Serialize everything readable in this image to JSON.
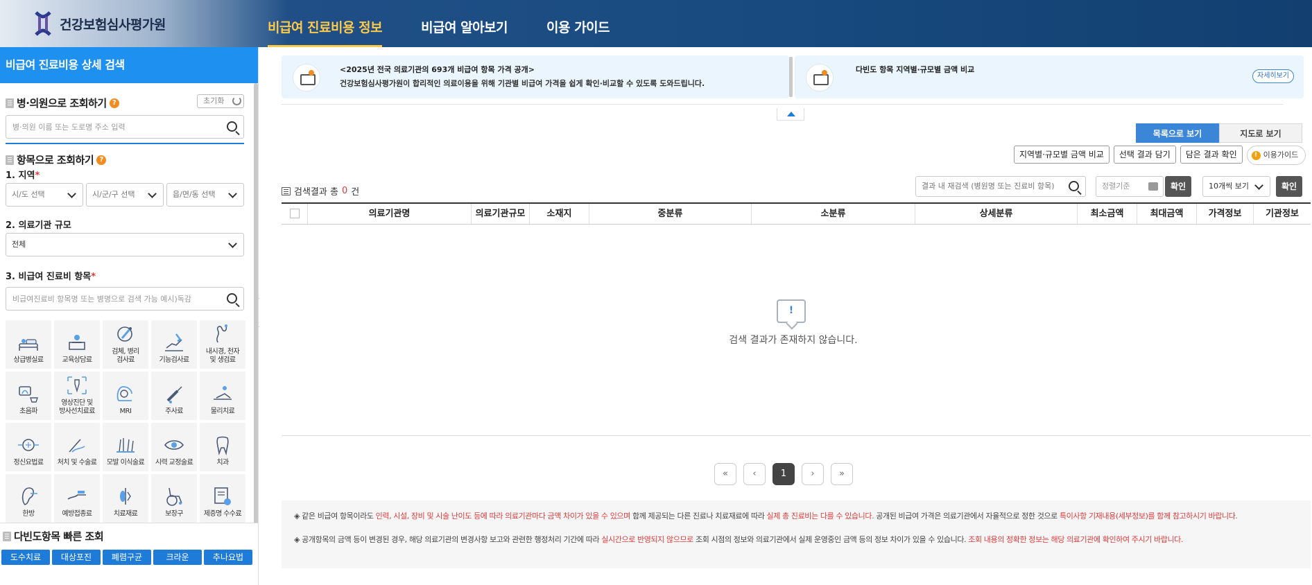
{
  "brand": {
    "name": "건강보험심사평가원"
  },
  "gnb": [
    {
      "label": "비급여 진료비용 정보"
    },
    {
      "label": "비급여 알아보기"
    },
    {
      "label": "이용 가이드"
    }
  ],
  "sidebar": {
    "title": "비급여 진료비용 상세 검색",
    "hospital_search": {
      "heading": "병·의원으로 조회하기",
      "reset_label": "초기화",
      "placeholder": "병·의원 이름 또는 도로명 주소 입력"
    },
    "item_search": {
      "heading": "항목으로 조회하기",
      "region_label": "1. 지역",
      "region_selects": [
        "시/도 선택",
        "시/군/구 선택",
        "읍/면/동 선택"
      ],
      "scale_label": "2. 의료기관 규모",
      "scale_value": "전체",
      "item_label": "3. 비급여 진료비 항목",
      "item_placeholder": "비급여진료비 항목명 또는 병명으로 검색 가능 예시)독감",
      "required_mark": "*"
    },
    "categories": [
      {
        "label": "상급병실료",
        "icon": "bed-icon"
      },
      {
        "label": "교육상담료",
        "icon": "counseling-icon"
      },
      {
        "label": "검체, 병리\n검사료",
        "icon": "test-tube-icon"
      },
      {
        "label": "기능검사료",
        "icon": "function-test-icon"
      },
      {
        "label": "내시경, 천자\n및 생검료",
        "icon": "endoscope-icon"
      },
      {
        "label": "초음파",
        "icon": "ultrasound-icon"
      },
      {
        "label": "영상진단 및\n방사선치료료",
        "icon": "radiology-icon"
      },
      {
        "label": "MRI",
        "icon": "mri-icon"
      },
      {
        "label": "주사료",
        "icon": "syringe-icon"
      },
      {
        "label": "물리치료",
        "icon": "physio-icon"
      },
      {
        "label": "정신요법료",
        "icon": "brain-icon"
      },
      {
        "label": "처치 및 수술료",
        "icon": "surgery-icon"
      },
      {
        "label": "모발 이식술료",
        "icon": "hair-icon"
      },
      {
        "label": "시력 교정술료",
        "icon": "eye-icon"
      },
      {
        "label": "치과",
        "icon": "tooth-icon"
      },
      {
        "label": "한방",
        "icon": "ear-acupuncture-icon"
      },
      {
        "label": "예방접종료",
        "icon": "vaccine-icon"
      },
      {
        "label": "치료재료",
        "icon": "material-icon"
      },
      {
        "label": "보장구",
        "icon": "wheelchair-icon"
      },
      {
        "label": "제증명 수수료",
        "icon": "certificate-icon"
      }
    ],
    "quick": {
      "heading": "다빈도항목 빠른 조회",
      "buttons": [
        "도수치료",
        "대상포진",
        "폐렴구균",
        "크라운",
        "추나요법"
      ]
    }
  },
  "main": {
    "banners": [
      {
        "line1": "<2025년 전국 의료기관의 693개 비급여 항목 가격 공개>",
        "line2": "건강보험심사평가원이 합리적인 의료이용을 위해 기관별 비급여 가격을 쉽게 확인·비교할 수 있도록 도와드립니다."
      },
      {
        "line1": "다빈도 항목 지역별·규모별 금액 비교",
        "more_label": "자세히보기"
      }
    ],
    "view_tabs": [
      "목록으로 보기",
      "지도로 보기"
    ],
    "actions": [
      "지역별·규모별 금액 비교",
      "선택 결과 담기",
      "담은 결과 확인"
    ],
    "guide_label": "이용가이드",
    "result": {
      "prefix": "검색결과 총",
      "count": "0",
      "suffix": "건"
    },
    "filter": {
      "search_placeholder": "결과 내 재검색 (병원명 또는 진료비 항목)",
      "sort_placeholder": "정렬기준",
      "confirm_label": "확인",
      "page_size": "10개씩 보기",
      "confirm2_label": "확인"
    },
    "columns": [
      "의료기관명",
      "의료기관규모",
      "소재지",
      "중분류",
      "소분류",
      "상세분류",
      "최소금액",
      "최대금액",
      "가격정보",
      "기관정보"
    ],
    "empty_message": "검색 결과가 존재하지 않습니다.",
    "pagination": {
      "current": "1"
    },
    "notice": {
      "p1_a": "◈ 같은 비급여 항목이라도 ",
      "p1_b": "인력, 시설, 장비 및 시술 난이도 등에 따라 의료기관마다 금액 차이가 있을 수 있으며",
      "p1_c": " 함께 제공되는 다른 진료나 치료재료에 따라 ",
      "p1_d": "실제 총 진료비는 다를 수 있습니다.",
      "p1_e": " 공개된 비급여 가격은 의료기관에서 자율적으로 정한 것으로 ",
      "p1_f": "특이사항 기재내용(세부정보)를 함께 참고하시기 바랍니다.",
      "p2_a": "◈ 공개항목의 금액 등이 변경된 경우, 해당 의료기관의 변경사항 보고와 관련한 행정처리 기간에 따라 ",
      "p2_b": "실시간으로 반영되지 않으므로",
      "p2_c": " 조회 시점의 정보와 의료기관에서 실제 운영중인 금액 등의 정보 차이가 있을 수 있습니다. ",
      "p2_d": "조회 내용의 정확한 정보는 해당 의료기관에 확인하여 주시기 바랍니다."
    }
  },
  "colors": {
    "primary": "#1e7bd8",
    "header": "#184a7f",
    "accent": "#ffc94a",
    "alert": "#e03a3a"
  }
}
